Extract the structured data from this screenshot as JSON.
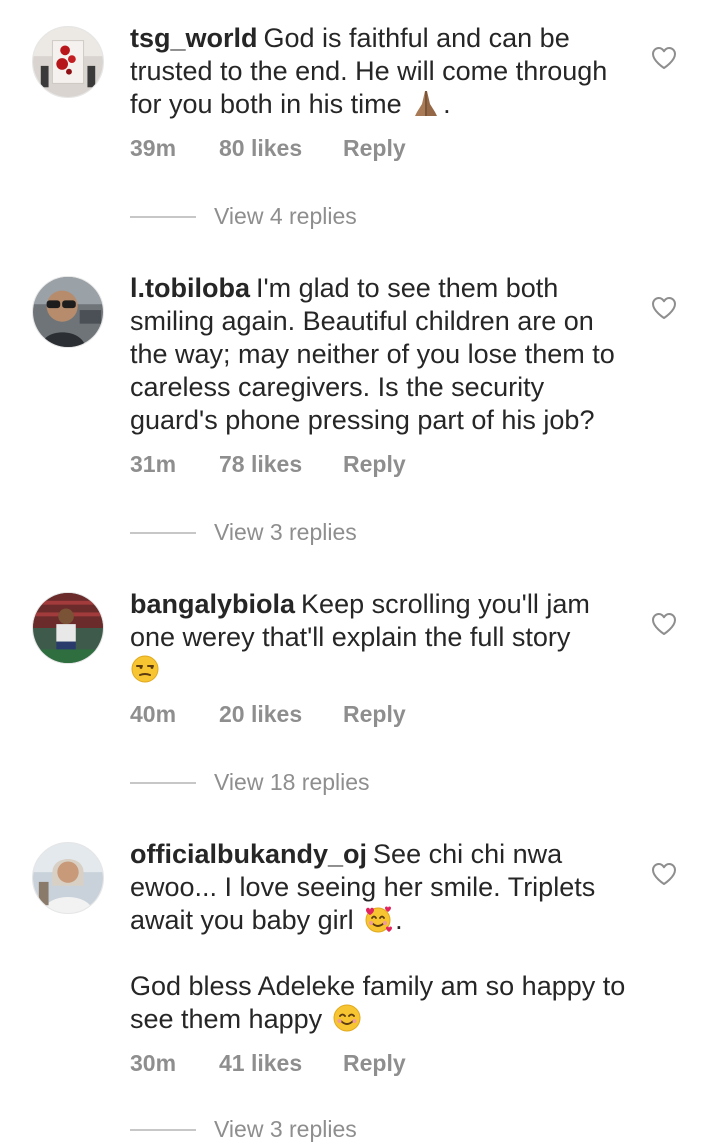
{
  "comments": [
    {
      "username": "tsg_world",
      "text": "God is faithful and can be trusted to the end. He will come through for you both in his time",
      "trailing_emoji": "folded-hands-icon",
      "trailing_text": ".",
      "time": "39m",
      "likes": "80 likes",
      "reply": "Reply",
      "view_replies": "View 4 replies"
    },
    {
      "username": "l.tobiloba",
      "text": "I'm glad to see them both smiling again. Beautiful children are on the way; may neither of you lose them to careless caregivers. Is the security guard's phone pressing part of his job?",
      "time": "31m",
      "likes": "78 likes",
      "reply": "Reply",
      "view_replies": "View 3 replies"
    },
    {
      "username": "bangalybiola",
      "text": "Keep scrolling you'll jam one werey that'll explain the full story",
      "trailing_emoji": "unamused-face-icon",
      "time": "40m",
      "likes": "20 likes",
      "reply": "Reply",
      "view_replies": "View 18 replies"
    },
    {
      "username": "officialbukandy_oj",
      "text": "See chi chi nwa ewoo... I love seeing her smile. Triplets await you baby girl",
      "trailing_emoji": "smiling-face-with-hearts-icon",
      "trailing_text": ".",
      "text2": "God bless Adeleke family am so happy to see them happy",
      "trailing_emoji2": "smiling-face-icon",
      "time": "30m",
      "likes": "41 likes",
      "reply": "Reply",
      "view_replies": "View 3 replies"
    }
  ],
  "colors": {
    "text": "#262626",
    "secondary": "#8e8e8e",
    "divider": "#c7c7c7",
    "background": "#ffffff"
  }
}
